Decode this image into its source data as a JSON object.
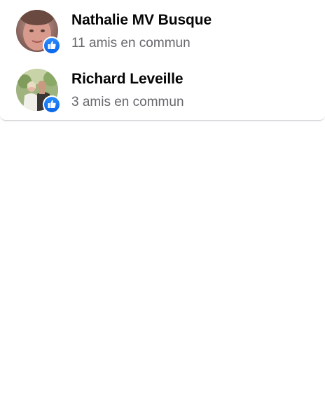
{
  "suggestions": [
    {
      "name": "Nathalie MV Busque",
      "mutual": "11 amis en commun",
      "avatar_icon": "profile-photo-woman",
      "badge_icon": "like-badge-icon"
    },
    {
      "name": "Richard Leveille",
      "mutual": "3 amis en commun",
      "avatar_icon": "profile-photo-couple",
      "badge_icon": "like-badge-icon"
    }
  ],
  "colors": {
    "name_text": "#050505",
    "secondary_text": "#65676b",
    "like_badge": "#1877f2"
  }
}
